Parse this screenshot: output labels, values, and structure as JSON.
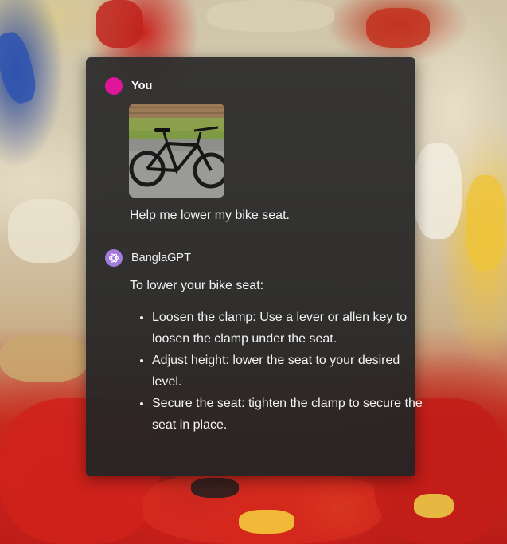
{
  "conversation": {
    "user": {
      "name": "You",
      "avatar_color": "#e0169a",
      "message": "Help me lower my bike seat."
    },
    "assistant": {
      "name": "BanglaGPT",
      "avatar_color": "#a37bdc",
      "avatar_icon": "openai-logo-icon",
      "intro": "To lower your bike seat:",
      "steps": [
        "Loosen the clamp: Use a lever or allen key to loosen the clamp under the seat.",
        "Adjust height: lower the seat to your desired level.",
        "Secure the seat: tighten the clamp to secure the seat in place."
      ]
    }
  },
  "colors": {
    "panel_background": "#2c2c2c",
    "text": "#f4f4f4"
  }
}
